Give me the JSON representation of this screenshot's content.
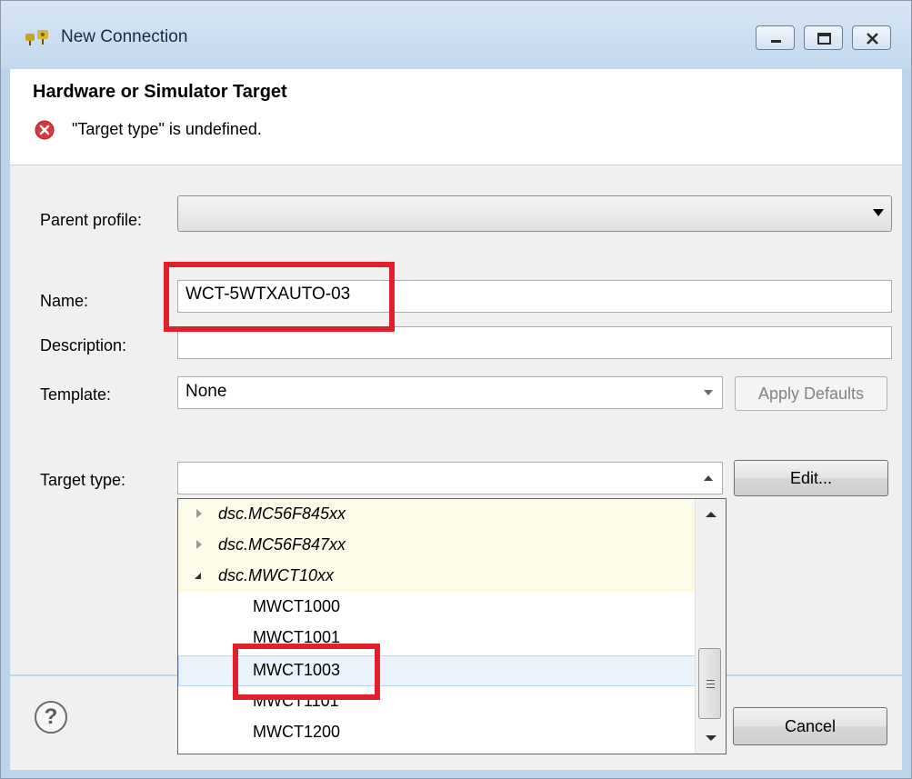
{
  "window": {
    "title": "New Connection",
    "minimize_label": "minimize",
    "maximize_label": "maximize",
    "close_label": "close"
  },
  "header": {
    "title": "Hardware or Simulator Target",
    "error_message": "\"Target type\" is undefined."
  },
  "form": {
    "parent_profile_label": "Parent profile:",
    "parent_profile_value": "",
    "name_label": "Name:",
    "name_value": "WCT-5WTXAUTO-03",
    "description_label": "Description:",
    "description_value": "",
    "template_label": "Template:",
    "template_value": "None",
    "apply_defaults_label": "Apply Defaults",
    "target_type_label": "Target type:",
    "target_type_value": "",
    "edit_label": "Edit..."
  },
  "target_list": {
    "items": [
      {
        "label": "dsc.MC56F845xx",
        "kind": "group",
        "expanded": false
      },
      {
        "label": "dsc.MC56F847xx",
        "kind": "group",
        "expanded": false
      },
      {
        "label": "dsc.MWCT10xx",
        "kind": "group",
        "expanded": true
      },
      {
        "label": "MWCT1000",
        "kind": "item"
      },
      {
        "label": "MWCT1001",
        "kind": "item"
      },
      {
        "label": "MWCT1003",
        "kind": "item",
        "selected": true
      },
      {
        "label": "MWCT1101",
        "kind": "item"
      },
      {
        "label": "MWCT1200",
        "kind": "item"
      }
    ]
  },
  "footer": {
    "cancel_label": "Cancel",
    "help_symbol": "?"
  },
  "colors": {
    "highlight": "#e0202b",
    "group_row_bg": "#fbfbe8",
    "error_icon": "#d9363e"
  }
}
